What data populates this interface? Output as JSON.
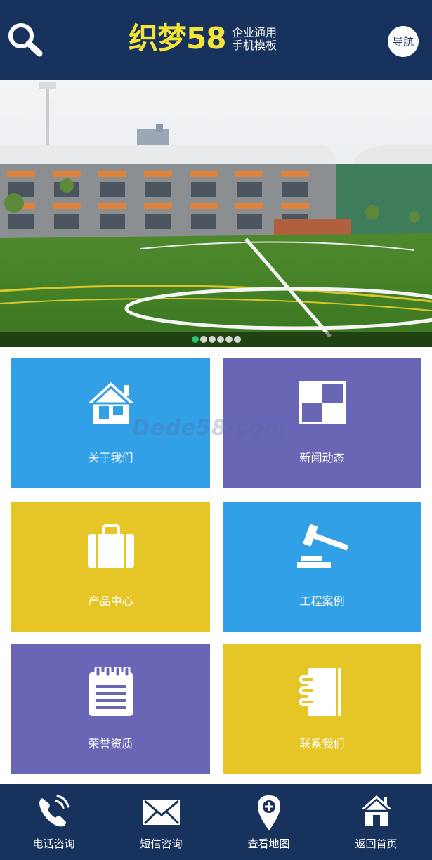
{
  "header": {
    "logo_main": "织梦58",
    "logo_sub_line1": "企业通用",
    "logo_sub_line2": "手机模板",
    "nav_label": "导航",
    "search_icon": "search-icon"
  },
  "banner": {
    "slide_count": 6,
    "active_slide": 1
  },
  "watermark": "Dede58·com",
  "tiles": [
    {
      "label": "关于我们",
      "icon": "house-icon",
      "color": "#31a0e6"
    },
    {
      "label": "新闻动态",
      "icon": "news-grid-icon",
      "color": "#6a66b6"
    },
    {
      "label": "产品中心",
      "icon": "briefcase-icon",
      "color": "#e6c626"
    },
    {
      "label": "工程案例",
      "icon": "gavel-icon",
      "color": "#31a0e6"
    },
    {
      "label": "荣誉资质",
      "icon": "notepad-icon",
      "color": "#6a66b6"
    },
    {
      "label": "联系我们",
      "icon": "address-book-icon",
      "color": "#e6c626"
    }
  ],
  "footer": [
    {
      "label": "电话咨询",
      "icon": "phone-icon"
    },
    {
      "label": "短信咨询",
      "icon": "envelope-icon"
    },
    {
      "label": "查看地图",
      "icon": "map-pin-icon"
    },
    {
      "label": "返回首页",
      "icon": "home-icon"
    }
  ],
  "colors": {
    "header_bg": "#18325e",
    "logo_yellow": "#f3e33a",
    "blue": "#31a0e6",
    "purple": "#6a66b6",
    "yellow": "#e6c626",
    "dot_active": "#2dbd6e"
  }
}
